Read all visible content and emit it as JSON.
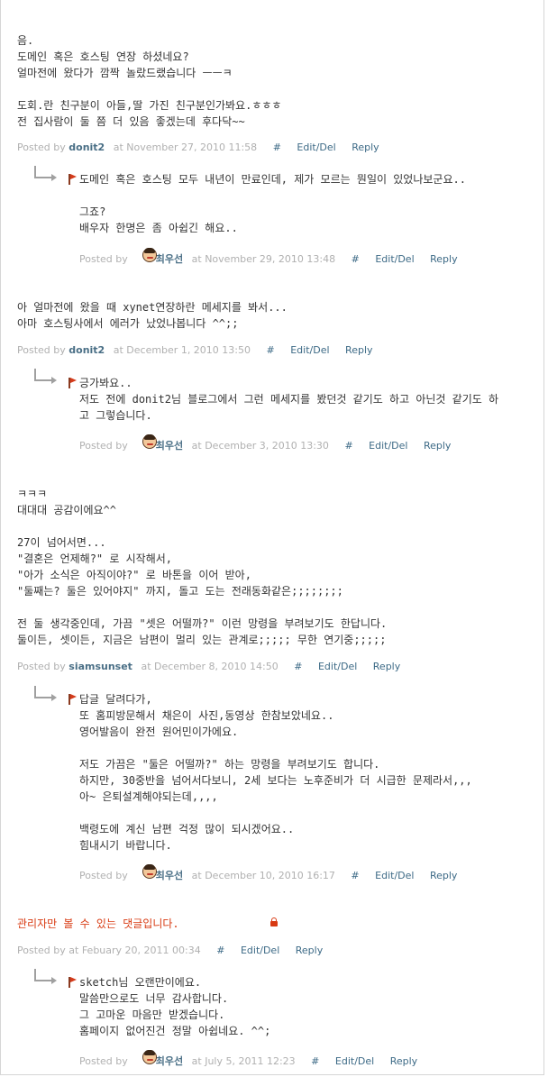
{
  "labels": {
    "posted_by": "Posted by",
    "at": "at",
    "hash": "#",
    "edit_del": "Edit/Del",
    "reply": "Reply"
  },
  "comments": [
    {
      "body": "음.\n도메인 혹은 호스팅 연장 하셨네요?\n얼마전에 왔다가 깜짝 놀랐드랬습니다 ㅡㅡㅋ\n\n도회.란 친구분이 아들,딸 가진 친구분인가봐요.ㅎㅎㅎ\n전 집사람이 둘 쯤 더 있음 좋겠는데 후다닥~~",
      "author": "donit2",
      "date": "November 27, 2010 11:58",
      "reply": {
        "body": "도메인 혹은 호스팅 모두 내년이 만료인데, 제가 모르는 뭔일이 있었나보군요..\n\n그죠?\n배우자 한명은 좀 아쉽긴 해요..",
        "author": "최우선",
        "date": "November 29, 2010 13:48"
      }
    },
    {
      "body": "아 얼마전에 왔을 때 xynet연장하란 메세지를 봐서...\n아마 호스팅사에서 에러가 났었나봅니다 ^^;;",
      "author": "donit2",
      "date": "December 1, 2010 13:50",
      "reply": {
        "body": "긍가봐요..\n저도 전에 donit2님 블로그에서 그런 메세지를 봤던것 같기도 하고 아닌것 같기도 하\n고 그렇습니다.",
        "author": "최우선",
        "date": "December 3, 2010 13:30"
      }
    },
    {
      "body": "ㅋㅋㅋ\n대대대 공감이에요^^\n\n27이 넘어서면...\n\"결혼은 언제해?\" 로 시작해서,\n\"아가 소식은 아직이야?\" 로 바톤을 이어 받아,\n\"둘째는? 둘은 있어야지\" 까지, 돌고 도는 전래동화같은;;;;;;;;\n\n전 둘 생각중인데, 가끔 \"셋은 어떨까?\" 이런 망령을 부려보기도 한답니다.\n둘이든, 셋이든, 지금은 남편이 멀리 있는 관계로;;;;; 무한 연기중;;;;;",
      "author": "siamsunset",
      "date": "December 8, 2010 14:50",
      "reply": {
        "body": "답글 달려다가,\n또 홈피방문해서 채은이 사진,동영상 한참보았네요..\n영어발음이 완전 원어민이가에요.\n\n저도 가끔은 \"둘은 어떨까?\" 하는 망령을 부려보기도 합니다.\n하지만, 30중반을 넘어서다보니, 2세 보다는 노후준비가 더 시급한 문제라서,,,\n아~ 은퇴설계해야되는데,,,,\n\n백령도에 계신 남편 걱정 많이 되시겠어요..\n힘내시기 바랍니다.",
        "author": "최우선",
        "date": "December 10, 2010 16:17"
      }
    },
    {
      "body": "관리자만 볼 수 있는 댓글입니다.",
      "author": "",
      "date": "Febuary 20, 2011 00:34",
      "reply": {
        "body": "sketch님 오랜만이에요.\n말씀만으로도 너무 감사합니다.\n그 고마운 마음만 받겠습니다.\n홈페이지 없어진건 정말 아쉽네요. ^^;",
        "author": "최우선",
        "date": "July 5, 2011 12:23"
      }
    }
  ]
}
